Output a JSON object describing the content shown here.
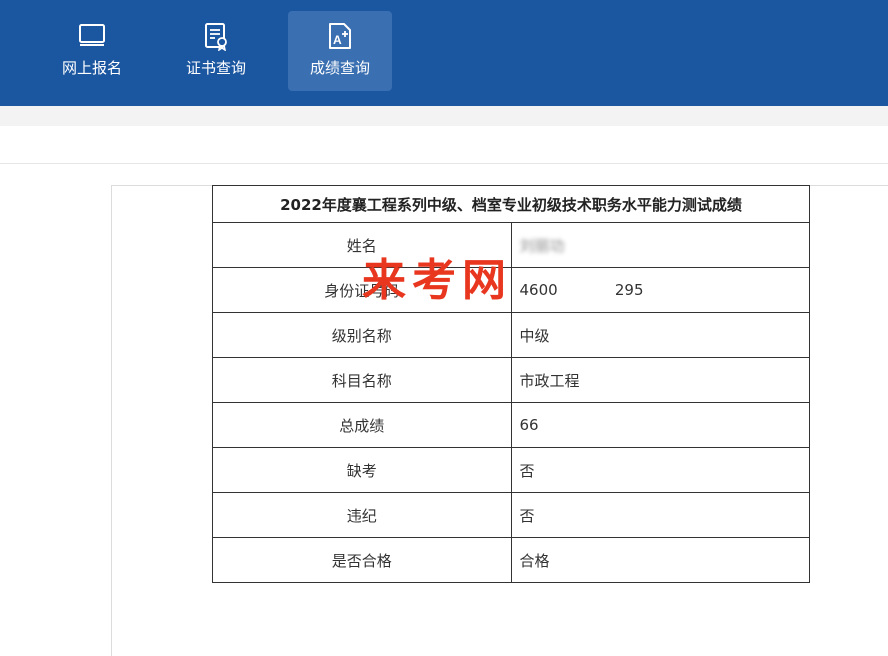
{
  "nav": {
    "items": [
      {
        "label": "网上报名",
        "icon": "monitor-icon"
      },
      {
        "label": "证书查询",
        "icon": "certificate-icon"
      },
      {
        "label": "成绩查询",
        "icon": "score-document-icon",
        "active": true
      }
    ]
  },
  "result": {
    "title": "2022年度襄工程系列中级、档室专业初级技术职务水平能力测试成绩",
    "rows": [
      {
        "label": "姓名",
        "value": "刘丽功"
      },
      {
        "label": "身份证号码",
        "value": "4600            295"
      },
      {
        "label": "级别名称",
        "value": "中级"
      },
      {
        "label": "科目名称",
        "value": "市政工程"
      },
      {
        "label": "总成绩",
        "value": "66"
      },
      {
        "label": "缺考",
        "value": "否"
      },
      {
        "label": "违纪",
        "value": "否"
      },
      {
        "label": "是否合格",
        "value": "合格"
      }
    ]
  },
  "watermark": "来考网",
  "colors": {
    "header_bg": "#1b56a0",
    "active_tab_bg": "#3a6fb1",
    "watermark": "#e8361f"
  }
}
